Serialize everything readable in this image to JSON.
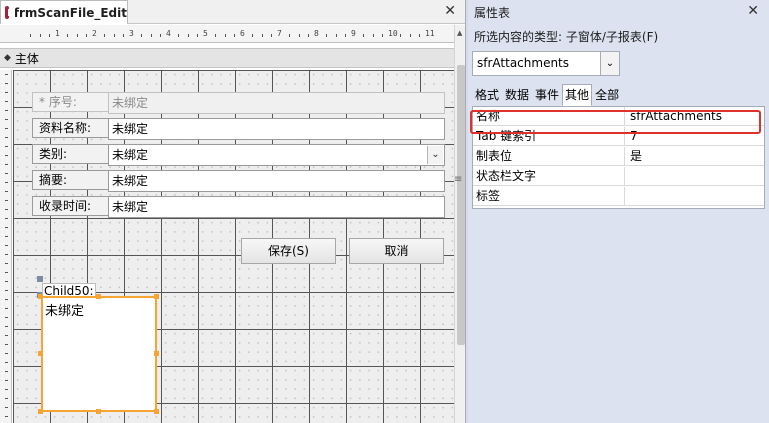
{
  "document": {
    "tab_title": "frmScanFile_Edit",
    "close_glyph": "✕"
  },
  "ruler": {
    "marks": [
      "1",
      "2",
      "3",
      "4",
      "5",
      "6",
      "7",
      "8",
      "9",
      "10",
      "11"
    ]
  },
  "section": {
    "label": "主体"
  },
  "form": {
    "fields": [
      {
        "label": "序号:",
        "value": "未绑定",
        "disabled": true
      },
      {
        "label": "资料名称:",
        "value": "未绑定"
      },
      {
        "label": "类别:",
        "value": "未绑定",
        "combo": true
      },
      {
        "label": "摘要:",
        "value": "未绑定"
      },
      {
        "label": "收录时间:",
        "value": "未绑定"
      }
    ],
    "save_button": "保存(S)",
    "cancel_button": "取消",
    "child_label": "Child50:",
    "subform_value": "未绑定"
  },
  "property_sheet": {
    "title": "属性表",
    "close_glyph": "✕",
    "selection_type": "所选内容的类型: 子窗体/子报表(F)",
    "selected_object": "sfrAttachments",
    "tabs": [
      "格式",
      "数据",
      "事件",
      "其他",
      "全部"
    ],
    "active_tab": "其他",
    "rows": [
      {
        "name": "名称",
        "value": "sfrAttachments"
      },
      {
        "name": "Tab 键索引",
        "value": "7"
      },
      {
        "name": "制表位",
        "value": "是"
      },
      {
        "name": "状态栏文字",
        "value": ""
      },
      {
        "name": "标签",
        "value": ""
      }
    ],
    "highlight_color": "#e0302c"
  },
  "colors": {
    "selection_outline": "#f4a534",
    "accent": "#a2223e"
  }
}
